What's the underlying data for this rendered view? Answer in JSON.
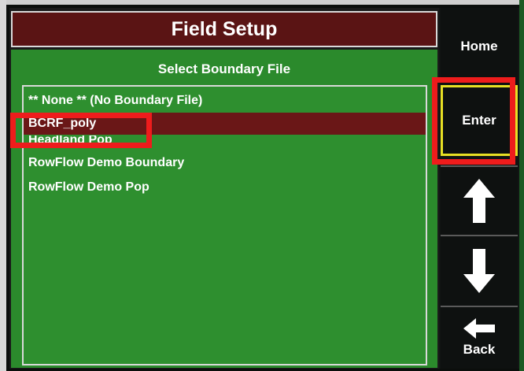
{
  "header": {
    "title": "Field Setup"
  },
  "panel": {
    "subtitle": "Select Boundary File"
  },
  "list": {
    "items": [
      {
        "label": "** None ** (No Boundary File)",
        "selected": false
      },
      {
        "label": "BCRF_poly",
        "selected": true
      },
      {
        "label": "Headland Pop",
        "selected": false
      },
      {
        "label": "RowFlow Demo Boundary",
        "selected": false
      },
      {
        "label": "RowFlow Demo Pop",
        "selected": false
      }
    ]
  },
  "sidebar": {
    "home_label": "Home",
    "enter_label": "Enter",
    "up_icon": "arrow-up-icon",
    "down_icon": "arrow-down-icon",
    "back_icon": "arrow-left-icon",
    "back_label": "Back"
  },
  "colors": {
    "title_bar": "#5a1414",
    "panel_green": "#2b8a2c",
    "selected_row": "#6a1717",
    "highlight_red": "#ee1c1c",
    "enter_border": "#e8e024"
  }
}
